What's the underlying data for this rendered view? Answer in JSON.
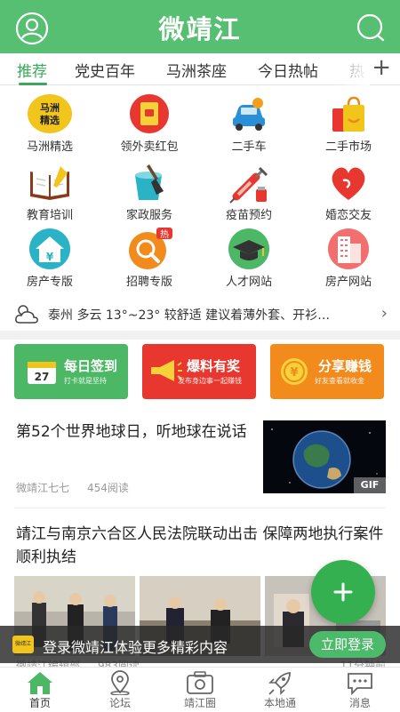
{
  "header": {
    "title": "微靖江"
  },
  "tabs": [
    {
      "label": "推荐"
    },
    {
      "label": "党史百年"
    },
    {
      "label": "马洲茶座"
    },
    {
      "label": "今日热帖"
    },
    {
      "label": "热"
    }
  ],
  "tab_add": "+",
  "grid": [
    {
      "label": "马洲精选",
      "icon": "mazhou-logo-icon",
      "logo_text": "马洲精选"
    },
    {
      "label": "领外卖红包",
      "icon": "red-envelope-icon"
    },
    {
      "label": "二手车",
      "icon": "car-icon"
    },
    {
      "label": "二手市场",
      "icon": "shopping-bag-icon"
    },
    {
      "label": "教育培训",
      "icon": "book-icon"
    },
    {
      "label": "家政服务",
      "icon": "bucket-icon"
    },
    {
      "label": "疫苗预约",
      "icon": "syringe-icon"
    },
    {
      "label": "婚恋交友",
      "icon": "heart-icon"
    },
    {
      "label": "房产专版",
      "icon": "house-icon"
    },
    {
      "label": "招聘专版",
      "icon": "recruit-icon",
      "badge": "热"
    },
    {
      "label": "人才网站",
      "icon": "graduation-cap-icon"
    },
    {
      "label": "房产网站",
      "icon": "building-icon"
    }
  ],
  "weather": {
    "text": "泰州 多云 13°~23° 较舒适 建议着薄外套、开衫…",
    "icon": "cloud-sun-icon"
  },
  "banners": [
    {
      "title": "每日签到",
      "sub": "打卡就是坚持",
      "badge": "27",
      "color": "#4cb865"
    },
    {
      "title": "爆料有奖",
      "sub": "发布身边事一起赚钱",
      "color": "#e8372e"
    },
    {
      "title": "分享赚钱",
      "sub": "好友查看就收金",
      "color": "#f28a1c"
    }
  ],
  "articles": [
    {
      "title": "第52个世界地球日，听地球在说话",
      "author": "微靖江七七",
      "reads": "454阅读",
      "thumb_badge": "GIF"
    },
    {
      "title": "靖江与南京六合区人民法院联动出击 保障两地执行案件顺利执结",
      "author": "微靖江编辑部",
      "reads": "983阅读",
      "time": "11分钟前"
    }
  ],
  "login_bar": {
    "text": "登录微靖江体验更多精彩内容",
    "button": "立即登录",
    "logo_text": "微靖江"
  },
  "fab": {
    "label": "+"
  },
  "bottom_nav": [
    {
      "label": "首页",
      "icon": "home-icon"
    },
    {
      "label": "论坛",
      "icon": "location-pin-icon"
    },
    {
      "label": "靖江圈",
      "icon": "camera-icon"
    },
    {
      "label": "本地通",
      "icon": "rocket-icon"
    },
    {
      "label": "消息",
      "icon": "message-icon"
    }
  ],
  "colors": {
    "brand": "#56bf72",
    "accent": "#3aa85a"
  }
}
